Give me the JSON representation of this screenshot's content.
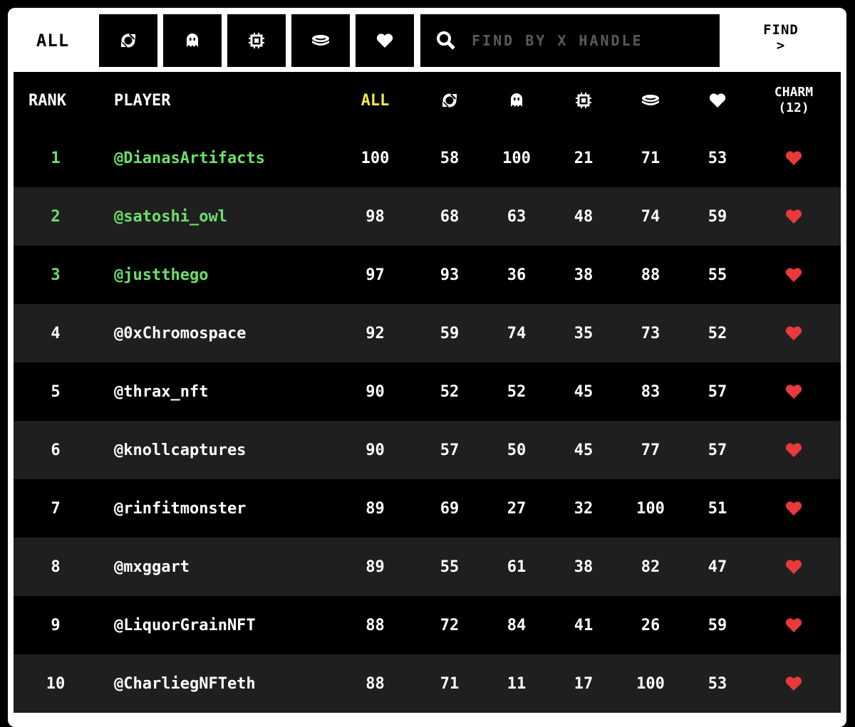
{
  "topbar": {
    "all_label": "ALL",
    "categories": [
      {
        "icon": "sync-icon"
      },
      {
        "icon": "ghost-icon"
      },
      {
        "icon": "chip-icon"
      },
      {
        "icon": "coin-stack-icon"
      },
      {
        "icon": "heart-icon"
      }
    ],
    "search_placeholder": "FIND BY X HANDLE",
    "search_value": "",
    "find_label": "FIND",
    "find_arrow": ">"
  },
  "table": {
    "headers": {
      "rank": "RANK",
      "player": "PLAYER",
      "all": "ALL",
      "charm_line1": "CHARM",
      "charm_line2": "(12)"
    },
    "colors": {
      "highlight_green": "#6de06a",
      "all_yellow": "#f3e84a",
      "heart_red": "#e8393b"
    },
    "rows": [
      {
        "rank": "1",
        "player": "@DianasArtifacts",
        "all": "100",
        "c1": "58",
        "c2": "100",
        "c3": "21",
        "c4": "71",
        "c5": "53",
        "top": true
      },
      {
        "rank": "2",
        "player": "@satoshi_owl",
        "all": "98",
        "c1": "68",
        "c2": "63",
        "c3": "48",
        "c4": "74",
        "c5": "59",
        "top": true
      },
      {
        "rank": "3",
        "player": "@justthego",
        "all": "97",
        "c1": "93",
        "c2": "36",
        "c3": "38",
        "c4": "88",
        "c5": "55",
        "top": true
      },
      {
        "rank": "4",
        "player": "@0xChromospace",
        "all": "92",
        "c1": "59",
        "c2": "74",
        "c3": "35",
        "c4": "73",
        "c5": "52",
        "top": false
      },
      {
        "rank": "5",
        "player": "@thrax_nft",
        "all": "90",
        "c1": "52",
        "c2": "52",
        "c3": "45",
        "c4": "83",
        "c5": "57",
        "top": false
      },
      {
        "rank": "6",
        "player": "@knollcaptures",
        "all": "90",
        "c1": "57",
        "c2": "50",
        "c3": "45",
        "c4": "77",
        "c5": "57",
        "top": false
      },
      {
        "rank": "7",
        "player": "@rinfitmonster",
        "all": "89",
        "c1": "69",
        "c2": "27",
        "c3": "32",
        "c4": "100",
        "c5": "51",
        "top": false
      },
      {
        "rank": "8",
        "player": "@mxggart",
        "all": "89",
        "c1": "55",
        "c2": "61",
        "c3": "38",
        "c4": "82",
        "c5": "47",
        "top": false
      },
      {
        "rank": "9",
        "player": "@LiquorGrainNFT",
        "all": "88",
        "c1": "72",
        "c2": "84",
        "c3": "41",
        "c4": "26",
        "c5": "59",
        "top": false
      },
      {
        "rank": "10",
        "player": "@CharliegNFTeth",
        "all": "88",
        "c1": "71",
        "c2": "11",
        "c3": "17",
        "c4": "100",
        "c5": "53",
        "top": false
      }
    ]
  }
}
